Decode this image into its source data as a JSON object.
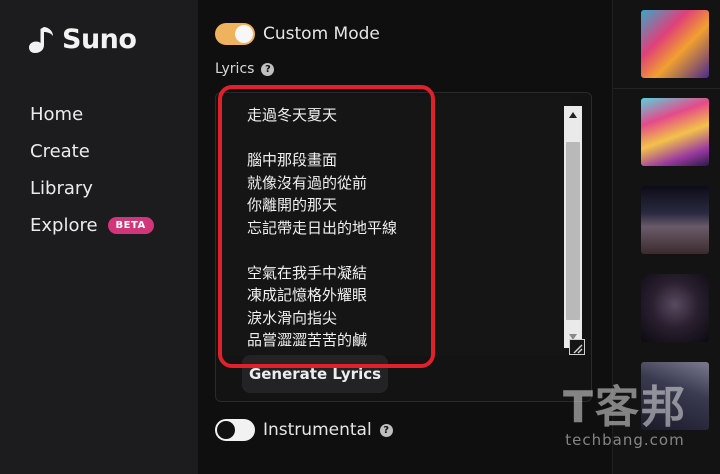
{
  "app": {
    "name": "Suno"
  },
  "sidebar": {
    "items": [
      {
        "label": "Home"
      },
      {
        "label": "Create"
      },
      {
        "label": "Library"
      },
      {
        "label": "Explore",
        "badge": "BETA"
      }
    ]
  },
  "form": {
    "custom_mode_label": "Custom Mode",
    "custom_mode_on": true,
    "lyrics_label": "Lyrics",
    "lyrics_value": "走過冬天夏天\n\n腦中那段畫面\n就像沒有過的從前\n你離開的那天\n忘記帶走日出的地平線\n\n空氣在我手中凝結\n凍成記憶格外耀眼\n淚水滑向指尖\n品嘗澀澀苦苦的鹹",
    "generate_lyrics_label": "Generate Lyrics",
    "instrumental_label": "Instrumental",
    "instrumental_on": false
  },
  "watermark": {
    "big": "T客邦",
    "small": "techbang.com"
  },
  "colors": {
    "accent": "#f0b35d",
    "beta_badge": "#d2367a",
    "highlight": "#e0202a"
  },
  "icons": {
    "help": "question-circle-icon",
    "logo": "suno-logo-icon"
  }
}
